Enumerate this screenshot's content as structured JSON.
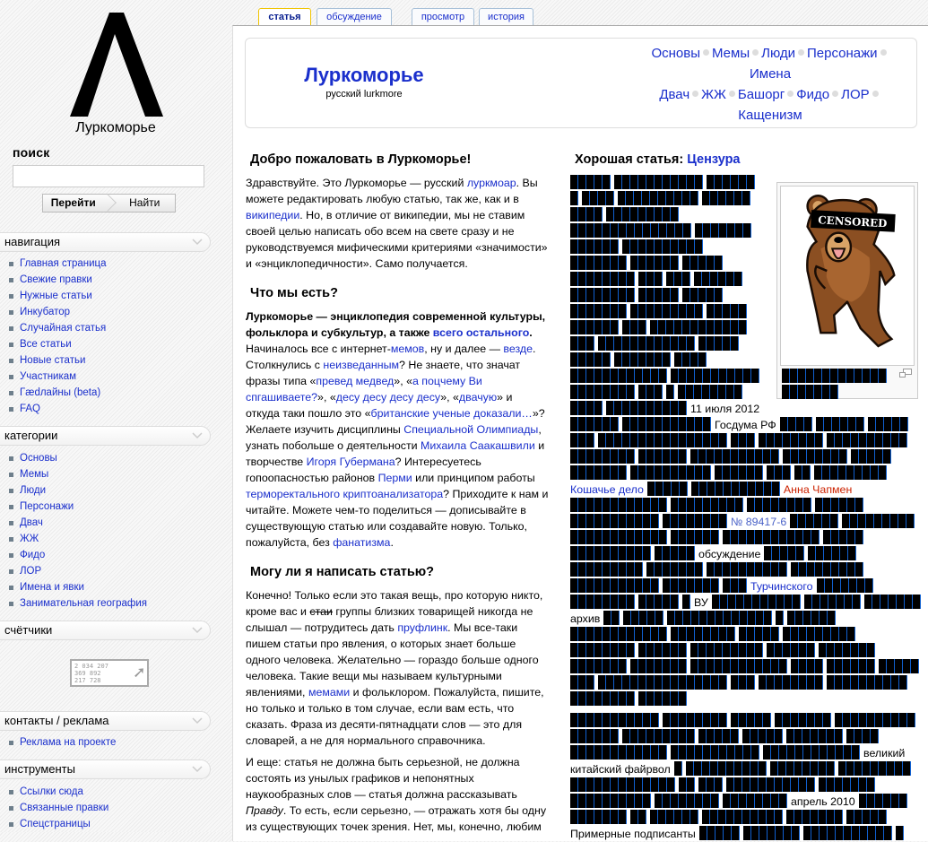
{
  "sidebar": {
    "logo_text": "Луркоморье",
    "search_label": "поиск",
    "search_value": "",
    "go_button": "Перейти",
    "find_button": "Найти",
    "navigation": {
      "title": "навигация",
      "items": [
        "Главная страница",
        "Свежие правки",
        "Нужные статьи",
        "Инкубатор",
        "Случайная статья",
        "Все статьи",
        "Новые статьи",
        "Участникам",
        "Гædлайны (beta)",
        "FAQ"
      ]
    },
    "categories": {
      "title": "категории",
      "items": [
        "Основы",
        "Мемы",
        "Люди",
        "Персонажи",
        "Двач",
        "ЖЖ",
        "Фидо",
        "ЛОР",
        "Имена и явки",
        "Занимательная география"
      ]
    },
    "counters": {
      "title": "счётчики",
      "lines": [
        "2 034 207",
        "369 892",
        "217 728"
      ]
    },
    "contacts": {
      "title": "контакты / реклама",
      "items": [
        "Реклама на проекте"
      ]
    },
    "tools": {
      "title": "инструменты",
      "items": [
        "Ссылки сюда",
        "Связанные правки",
        "Спецстраницы"
      ]
    }
  },
  "tabs": [
    "статья",
    "обсуждение",
    "просмотр",
    "история"
  ],
  "header": {
    "title": "Луркоморье",
    "subtitle": "русский lurkmore",
    "nav": [
      "Основы",
      "Мемы",
      "Люди",
      "Персонажи",
      "Имена",
      "Двач",
      "ЖЖ",
      "Башорг",
      "Фидо",
      "ЛОР",
      "Кащенизм"
    ]
  },
  "welcome": {
    "title": "Добро пожаловать в Луркоморье!",
    "p1": [
      [
        "Здравствуйте. Это Луркоморье — русский ",
        0
      ],
      [
        "луркмоар",
        1
      ],
      [
        ". Вы можете редактировать любую статью, так же, как и в ",
        0
      ],
      [
        "википедии",
        1
      ],
      [
        ". Но, в отличие от википедии, мы не ставим своей целью написать обо всем на свете сразу и не руководствуемся мифическими критериями «значимости» и «энциклопедичности». Само получается.",
        0
      ]
    ]
  },
  "what": {
    "title": "Что мы есть?",
    "p1": [
      [
        "Луркоморье — энциклопедия современной культуры, фольклора и субкультур, а также ",
        2
      ],
      [
        "всего остального",
        3
      ],
      [
        ".",
        2
      ],
      [
        " Начиналось все с интернет-",
        0
      ],
      [
        "мемов",
        1
      ],
      [
        ", ну и далее — ",
        0
      ],
      [
        "везде",
        1
      ],
      [
        ". Столкнулись с ",
        0
      ],
      [
        "неизведанным",
        1
      ],
      [
        "? Не знаете, что значат фразы типа «",
        0
      ],
      [
        "превед медвед",
        1
      ],
      [
        "», «",
        0
      ],
      [
        "а поцчему Ви спгашиваете?",
        1
      ],
      [
        "», «",
        0
      ],
      [
        "десу десу десу десу",
        1
      ],
      [
        "», «",
        0
      ],
      [
        "двачую",
        1
      ],
      [
        "» и откуда таки пошло это «",
        0
      ],
      [
        "британские ученые доказали…",
        1
      ],
      [
        "»? Желаете изучить дисциплины ",
        0
      ],
      [
        "Специальной Олимпиады",
        1
      ],
      [
        ", узнать побольше о деятельности ",
        0
      ],
      [
        "Михаила Саакашвили",
        1
      ],
      [
        " и творчестве ",
        0
      ],
      [
        "Игоря Губермана",
        1
      ],
      [
        "? Интересуетесь гопоопасностью районов ",
        0
      ],
      [
        "Перми",
        1
      ],
      [
        " или принципом работы ",
        0
      ],
      [
        "терморектального криптоанализатора",
        1
      ],
      [
        "? Приходите к нам и читайте. Можете чем-то поделиться — дописывайте в существующую статью или создавайте новую. Только, пожалуйста, без ",
        0
      ],
      [
        "фанатизма",
        1
      ],
      [
        ".",
        0
      ]
    ]
  },
  "can_write": {
    "title": "Могу ли я написать статью?",
    "p1": [
      [
        "Конечно! Только если это такая вещь, про которую никто, кроме вас и ",
        0
      ],
      [
        "стаи",
        4
      ],
      [
        " группы близких товарищей никогда не слышал — потрудитесь дать ",
        0
      ],
      [
        "пруфлинк",
        1
      ],
      [
        ". Мы все-таки пишем статьи про явления, о которых знает больше одного человека. Желательно — гораздо больше одного человека. Такие вещи мы называем культурными явлениями, ",
        0
      ],
      [
        "мемами",
        1
      ],
      [
        " и фольклором. Пожалуйста, пишите, но только и только в том случае, если вам есть, что сказать. Фраза из десяти-пятнадцати слов — это для словарей, а не для нормального справочника.",
        0
      ]
    ],
    "p2": [
      [
        "И еще: статья не должна быть серьезной, не должна состоять из унылых графиков и непонятных наукообразных слов — статья должна рассказывать ",
        0
      ],
      [
        "Правду",
        5
      ],
      [
        ". То есть, если серьезно, — отражать хотя бы одну из существующих точек зрения. Нет, мы, конечно, любим",
        0
      ]
    ]
  },
  "good_article": {
    "title_prefix": "Хорошая статья: ",
    "title_link": "Цензура",
    "image_caption_text": "CENSORED",
    "paragraph1": [
      [
        5,
        11,
        6
      ],
      [
        1,
        4,
        10,
        6
      ],
      [
        4,
        9
      ],
      [
        15,
        7
      ],
      [
        6,
        10
      ],
      [
        7,
        6,
        5
      ],
      [
        8,
        3,
        3,
        6
      ],
      [
        8,
        5,
        5
      ],
      [
        7,
        9,
        5
      ],
      [
        6,
        3,
        12
      ],
      [
        3,
        12,
        5
      ],
      [
        5,
        7,
        4
      ],
      [
        12,
        11
      ],
      [
        8,
        3,
        1,
        8
      ],
      [
        4,
        10,
        "11 июля 2012"
      ],
      [
        6,
        11,
        "Госдума РФ",
        4,
        6,
        5
      ],
      [
        3,
        16,
        3,
        8,
        10
      ],
      [
        8,
        6,
        11,
        8,
        5
      ],
      [
        7,
        10,
        6,
        3,
        2,
        9
      ],
      [
        {
          "link": "Кошачье дело"
        },
        5,
        11,
        {
          "red": "Анна Чапмен"
        }
      ],
      [
        12,
        9,
        8,
        6
      ],
      [
        11,
        8,
        {
          "visited": "№ 89417-6"
        },
        6,
        9
      ],
      [
        12,
        6,
        12,
        5
      ],
      [
        10,
        5,
        "обсуждение",
        5,
        6
      ],
      [
        9,
        7,
        10,
        9
      ],
      [
        11,
        7,
        3,
        {
          "link": "Турчинского"
        },
        7
      ],
      [
        8,
        5,
        1,
        "ВУ",
        11,
        7,
        7
      ],
      [
        "архив",
        2,
        5,
        13,
        1,
        6
      ],
      [
        12,
        8,
        5,
        9
      ],
      [
        8,
        6,
        9,
        6,
        7
      ],
      [
        7,
        7,
        12,
        4,
        6,
        5
      ],
      [
        3,
        16,
        3,
        8,
        10
      ],
      [
        8,
        6
      ]
    ],
    "paragraph2": [
      [
        11,
        8,
        5,
        7,
        10
      ],
      [
        6,
        9,
        5,
        5,
        7,
        4
      ],
      [
        12,
        11,
        12,
        "великий"
      ],
      [
        "китайский файрвол",
        1,
        10,
        8,
        9
      ],
      [
        13,
        2,
        3,
        11,
        7
      ],
      [
        10,
        8,
        8,
        "апрель 2010",
        6
      ],
      [
        7,
        2,
        6,
        10,
        7,
        5
      ],
      [
        "Примерные подписанты",
        5,
        7,
        11,
        1
      ]
    ],
    "caption_redacted": [
      [
        13
      ],
      [
        7
      ]
    ]
  }
}
